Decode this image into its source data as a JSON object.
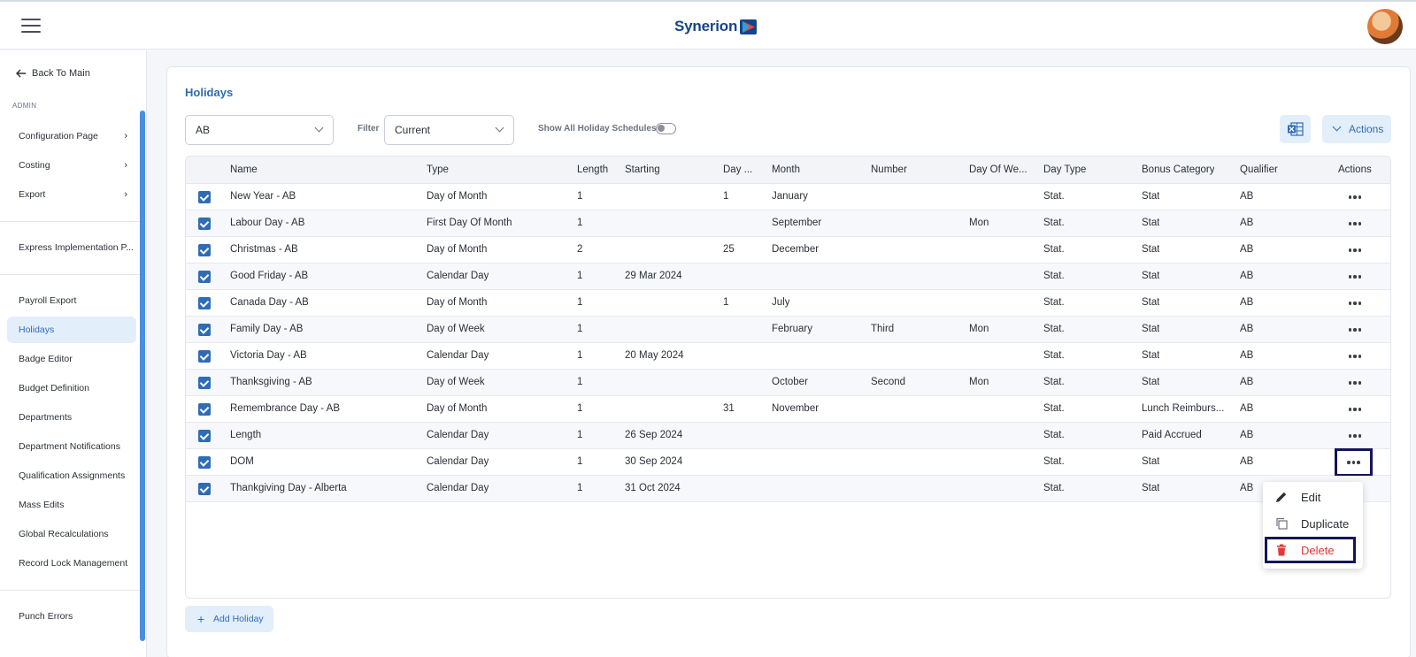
{
  "header": {
    "brand": "Synerion"
  },
  "sidebar": {
    "back_label": "Back To Main",
    "section": "ADMIN",
    "items": [
      {
        "label": "Configuration Page"
      },
      {
        "label": "Costing"
      },
      {
        "label": "Export"
      },
      {
        "label": "Express Implementation P..."
      },
      {
        "label": "Payroll Export"
      },
      {
        "label": "Holidays"
      },
      {
        "label": "Badge Editor"
      },
      {
        "label": "Budget Definition"
      },
      {
        "label": "Departments"
      },
      {
        "label": "Department Notifications"
      },
      {
        "label": "Qualification Assignments"
      },
      {
        "label": "Mass Edits"
      },
      {
        "label": "Global Recalculations"
      },
      {
        "label": "Record Lock Management"
      },
      {
        "label": "Punch Errors"
      }
    ]
  },
  "page": {
    "title": "Holidays"
  },
  "controls": {
    "region_value": "AB",
    "filter_label": "Filter",
    "filter_value": "Current",
    "toggle_label": "Show All Holiday Schedules",
    "actions_label": "Actions",
    "add_label": "Add Holiday"
  },
  "table": {
    "columns": [
      "Name",
      "Type",
      "Length",
      "Starting",
      "Day ...",
      "Month",
      "Number",
      "Day Of We...",
      "Day Type",
      "Bonus Category",
      "Qualifier",
      "Actions"
    ],
    "rows": [
      {
        "name": "New Year - AB",
        "type": "Day of Month",
        "length": "1",
        "starting": "",
        "day": "1",
        "month": "January",
        "number": "",
        "dow": "",
        "daytype": "Stat.",
        "bonus": "Stat",
        "qualifier": "AB"
      },
      {
        "name": "Labour Day - AB",
        "type": "First Day Of Month",
        "length": "1",
        "starting": "",
        "day": "",
        "month": "September",
        "number": "",
        "dow": "Mon",
        "daytype": "Stat.",
        "bonus": "Stat",
        "qualifier": "AB"
      },
      {
        "name": "Christmas - AB",
        "type": "Day of Month",
        "length": "2",
        "starting": "",
        "day": "25",
        "month": "December",
        "number": "",
        "dow": "",
        "daytype": "Stat.",
        "bonus": "Stat",
        "qualifier": "AB"
      },
      {
        "name": "Good Friday - AB",
        "type": "Calendar Day",
        "length": "1",
        "starting": "29 Mar 2024",
        "day": "",
        "month": "",
        "number": "",
        "dow": "",
        "daytype": "Stat.",
        "bonus": "Stat",
        "qualifier": "AB"
      },
      {
        "name": "Canada Day - AB",
        "type": "Day of Month",
        "length": "1",
        "starting": "",
        "day": "1",
        "month": "July",
        "number": "",
        "dow": "",
        "daytype": "Stat.",
        "bonus": "Stat",
        "qualifier": "AB"
      },
      {
        "name": "Family Day - AB",
        "type": "Day of Week",
        "length": "1",
        "starting": "",
        "day": "",
        "month": "February",
        "number": "Third",
        "dow": "Mon",
        "daytype": "Stat.",
        "bonus": "Stat",
        "qualifier": "AB"
      },
      {
        "name": "Victoria Day - AB",
        "type": "Calendar Day",
        "length": "1",
        "starting": "20 May 2024",
        "day": "",
        "month": "",
        "number": "",
        "dow": "",
        "daytype": "Stat.",
        "bonus": "Stat",
        "qualifier": "AB"
      },
      {
        "name": "Thanksgiving - AB",
        "type": "Day of Week",
        "length": "1",
        "starting": "",
        "day": "",
        "month": "October",
        "number": "Second",
        "dow": "Mon",
        "daytype": "Stat.",
        "bonus": "Stat",
        "qualifier": "AB"
      },
      {
        "name": "Remembrance Day - AB",
        "type": "Day of Month",
        "length": "1",
        "starting": "",
        "day": "31",
        "month": "November",
        "number": "",
        "dow": "",
        "daytype": "Stat.",
        "bonus": "Lunch Reimburs...",
        "qualifier": "AB"
      },
      {
        "name": "Length",
        "type": "Calendar Day",
        "length": "1",
        "starting": "26 Sep 2024",
        "day": "",
        "month": "",
        "number": "",
        "dow": "",
        "daytype": "Stat.",
        "bonus": "Paid Accrued",
        "qualifier": "AB"
      },
      {
        "name": "DOM",
        "type": "Calendar Day",
        "length": "1",
        "starting": "30 Sep 2024",
        "day": "",
        "month": "",
        "number": "",
        "dow": "",
        "daytype": "Stat.",
        "bonus": "Stat",
        "qualifier": "AB"
      },
      {
        "name": "Thankgiving Day - Alberta",
        "type": "Calendar Day",
        "length": "1",
        "starting": "31 Oct 2024",
        "day": "",
        "month": "",
        "number": "",
        "dow": "",
        "daytype": "Stat.",
        "bonus": "Stat",
        "qualifier": "AB"
      }
    ]
  },
  "context_menu": {
    "edit": "Edit",
    "duplicate": "Duplicate",
    "delete": "Delete"
  },
  "colors": {
    "accent": "#2f6cb5",
    "danger": "#e53935",
    "highlight_outline": "#14145a",
    "brand": "#16448a"
  }
}
